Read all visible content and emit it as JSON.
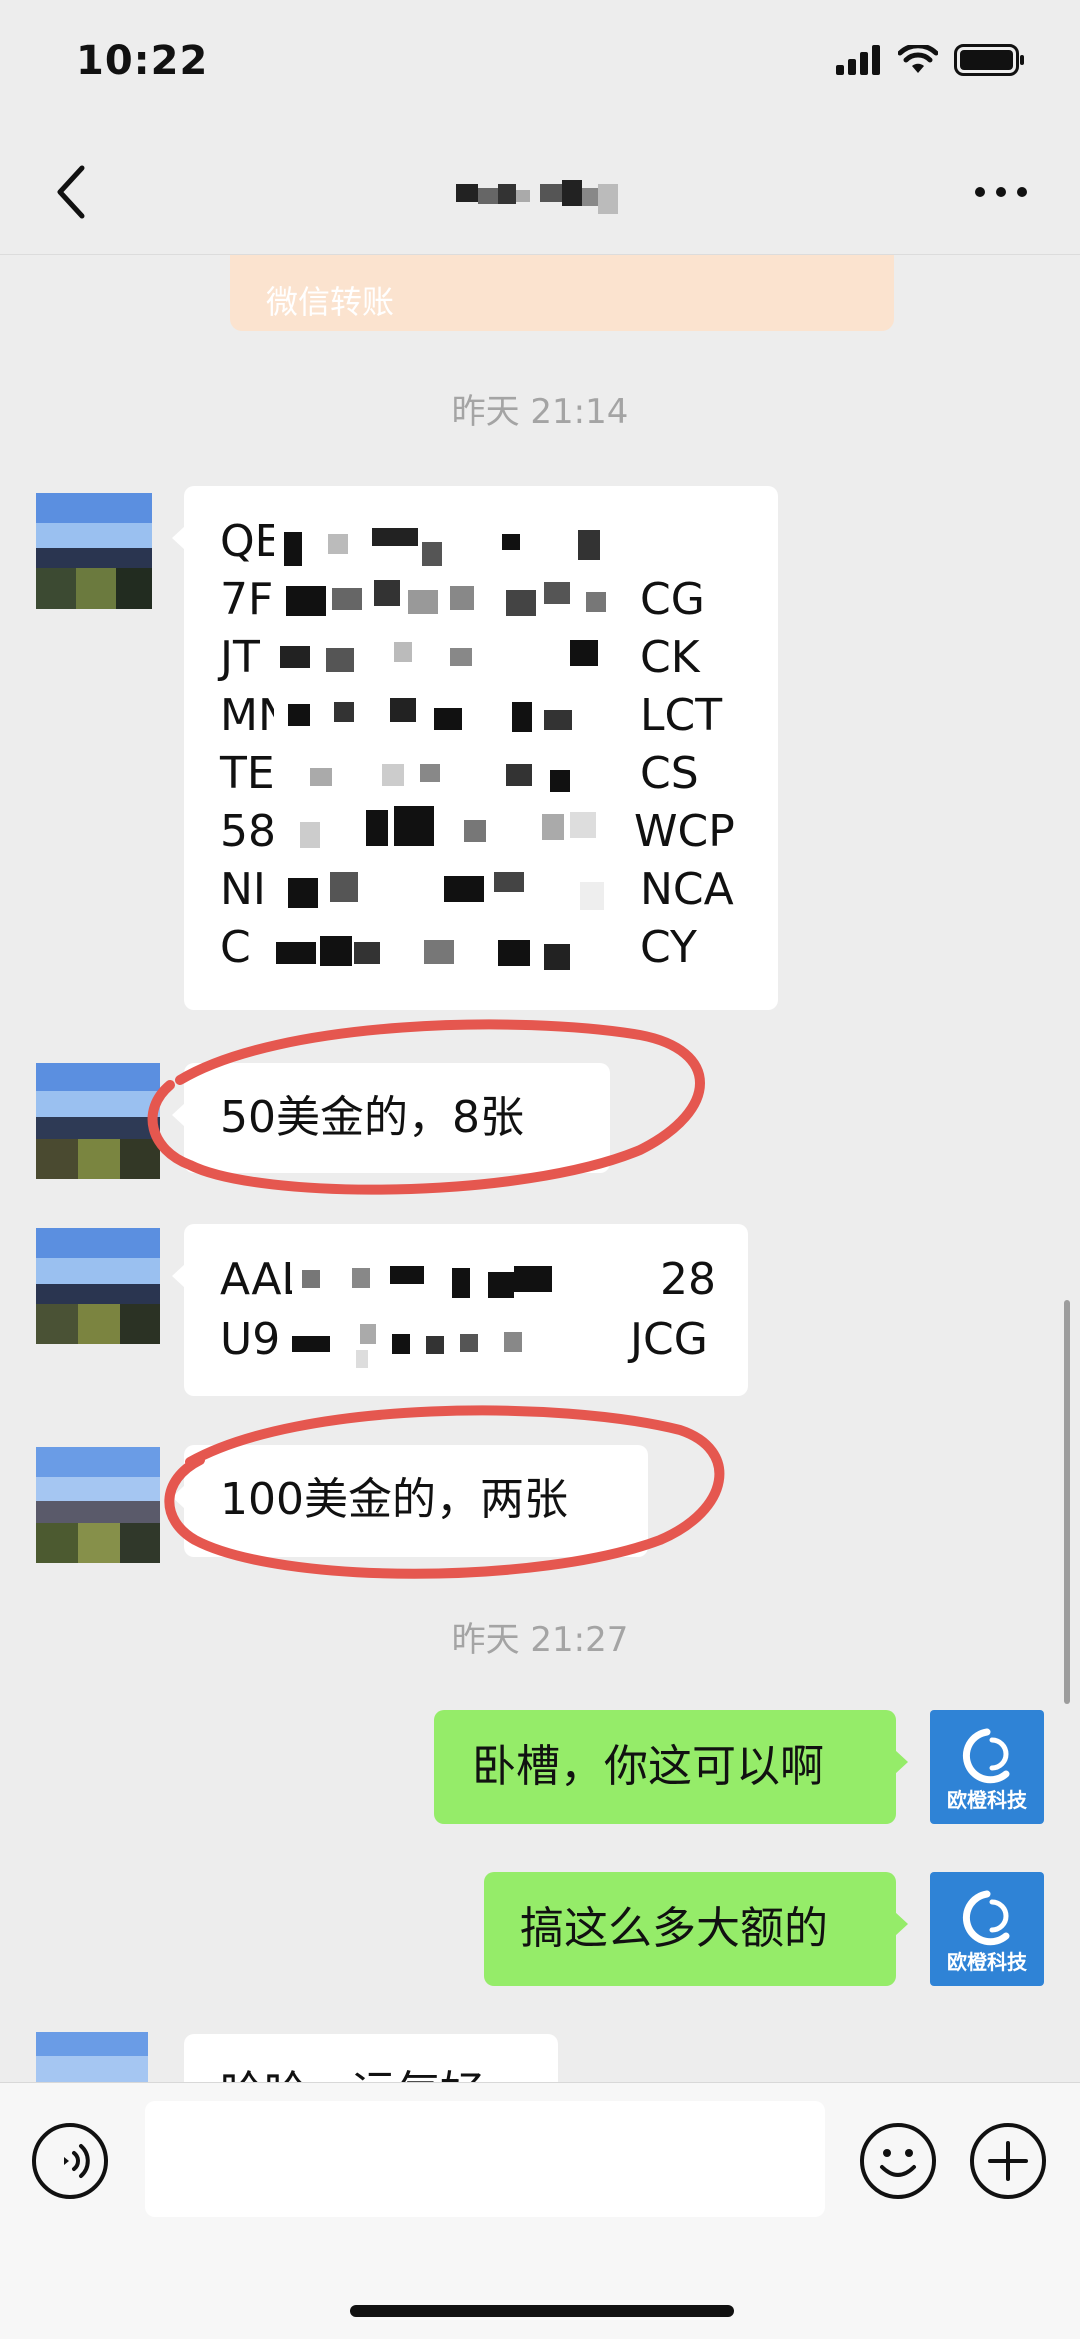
{
  "status_bar": {
    "time": "10:22"
  },
  "nav": {
    "back_icon": "chevron-left-icon",
    "more_icon": "more-horizontal-icon"
  },
  "transfer": {
    "label": "微信转账"
  },
  "timestamps": {
    "first": "昨天 21:14",
    "second": "昨天 21:27"
  },
  "codes_block_1": {
    "lines": [
      {
        "start": "QE",
        "end": ""
      },
      {
        "start": "7F",
        "end": "CG"
      },
      {
        "start": "JT",
        "end": "CK"
      },
      {
        "start": "MN",
        "end": "LCT"
      },
      {
        "start": "TE",
        "end": "CS"
      },
      {
        "start": "58",
        "end": "WCP"
      },
      {
        "start": "NI",
        "end": "NCA"
      },
      {
        "start": "C",
        "end": "CY"
      }
    ]
  },
  "msg_50": "50美金的，8张",
  "codes_block_2": {
    "lines": [
      {
        "start": "AAL",
        "end": "28"
      },
      {
        "start": "U9",
        "end": "JCG"
      }
    ]
  },
  "msg_100": "100美金的，两张",
  "my_msg_1": "卧槽，你这可以啊",
  "my_msg_2": "搞这么多大额的",
  "my_avatar_label": "欧橙科技",
  "partial_msg": "哈哈，运气好",
  "annotation_color": "#e5574f",
  "colors": {
    "bubble_green": "#95ec69",
    "background": "#ededed"
  },
  "input_bar": {
    "voice_icon": "voice-icon",
    "emoji_icon": "emoji-icon",
    "add_icon": "plus-circle-icon"
  }
}
